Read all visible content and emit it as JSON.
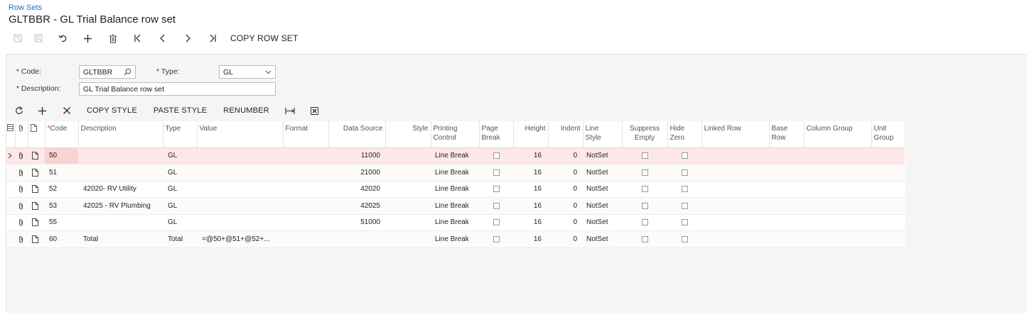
{
  "breadcrumb": "Row Sets",
  "title": "GLTBBR - GL Trial Balance row set",
  "toolbar": {
    "icons": [
      "save-close-icon",
      "save-icon",
      "undo-icon",
      "add-icon",
      "delete-icon",
      "first-icon",
      "prev-icon",
      "next-icon",
      "last-icon"
    ],
    "copy_row_set": "COPY ROW SET"
  },
  "form": {
    "code_label": "Code:",
    "code_value": "GLTBBR",
    "type_label": "Type:",
    "type_value": "GL",
    "description_label": "Description:",
    "description_value": "GL Trial Balance row set",
    "required_mark": "*"
  },
  "grid_toolbar": {
    "copy_style": "COPY STYLE",
    "paste_style": "PASTE STYLE",
    "renumber": "RENUMBER"
  },
  "grid": {
    "headers": {
      "code_star": "*",
      "code": "Code",
      "description": "Description",
      "type": "Type",
      "value": "Value",
      "format": "Format",
      "data_source": "Data Source",
      "style": "Style",
      "printing_control_1": "Printing",
      "printing_control_2": "Control",
      "page_break_1": "Page",
      "page_break_2": "Break",
      "height": "Height",
      "indent": "Indent",
      "line_style_1": "Line",
      "line_style_2": "Style",
      "suppress_empty_1": "Suppress",
      "suppress_empty_2": "Empty",
      "hide_zero_1": "Hide",
      "hide_zero_2": "Zero",
      "linked_row": "Linked Row",
      "base_row_1": "Base",
      "base_row_2": "Row",
      "column_group": "Column Group",
      "unit_group_1": "Unit",
      "unit_group_2": "Group"
    },
    "rows": [
      {
        "code": "50",
        "description": "",
        "type": "GL",
        "value": "",
        "format": "",
        "data_source": "11000",
        "style": "",
        "printing_control": "Line Break",
        "height": "16",
        "indent": "0",
        "line_style": "NotSet"
      },
      {
        "code": "51",
        "description": "",
        "type": "GL",
        "value": "",
        "format": "",
        "data_source": "21000",
        "style": "",
        "printing_control": "Line Break",
        "height": "16",
        "indent": "0",
        "line_style": "NotSet"
      },
      {
        "code": "52",
        "description": "42020- RV Utility",
        "type": "GL",
        "value": "",
        "format": "",
        "data_source": "42020",
        "style": "",
        "printing_control": "Line Break",
        "height": "16",
        "indent": "0",
        "line_style": "NotSet"
      },
      {
        "code": "53",
        "description": "42025 - RV Plumbing",
        "type": "GL",
        "value": "",
        "format": "",
        "data_source": "42025",
        "style": "",
        "printing_control": "Line Break",
        "height": "16",
        "indent": "0",
        "line_style": "NotSet"
      },
      {
        "code": "55",
        "description": "",
        "type": "GL",
        "value": "",
        "format": "",
        "data_source": "51000",
        "style": "",
        "printing_control": "Line Break",
        "height": "16",
        "indent": "0",
        "line_style": "NotSet"
      },
      {
        "code": "60",
        "description": "Total",
        "type": "Total",
        "value": "=@50+@51+@52+...",
        "format": "",
        "data_source": "",
        "style": "",
        "printing_control": "Line Break",
        "height": "16",
        "indent": "0",
        "line_style": "NotSet"
      }
    ]
  }
}
